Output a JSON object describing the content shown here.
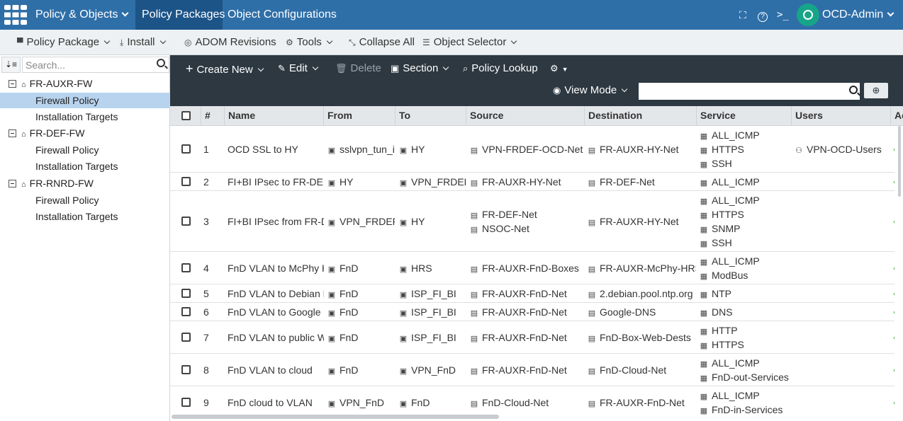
{
  "topbar": {
    "menu_label": "Policy & Objects",
    "tab_packages": "Policy Packages",
    "tab_objects": "Object Configurations",
    "user": "OCD-Admin"
  },
  "toolbar": {
    "policy_package": "Policy Package",
    "install": "Install",
    "adom_revisions": "ADOM Revisions",
    "tools": "Tools",
    "collapse_all": "Collapse All",
    "object_selector": "Object Selector"
  },
  "sidebar": {
    "search_placeholder": "Search...",
    "devices": [
      {
        "name": "FR-AUXR-FW",
        "policy": "Firewall Policy",
        "targets": "Installation Targets"
      },
      {
        "name": "FR-DEF-FW",
        "policy": "Firewall Policy",
        "targets": "Installation Targets"
      },
      {
        "name": "FR-RNRD-FW",
        "policy": "Firewall Policy",
        "targets": "Installation Targets"
      }
    ]
  },
  "actions": {
    "create_new": "Create New",
    "edit": "Edit",
    "delete": "Delete",
    "section": "Section",
    "policy_lookup": "Policy Lookup",
    "view_mode": "View Mode"
  },
  "table": {
    "headers": {
      "num": "#",
      "name": "Name",
      "from": "From",
      "to": "To",
      "source": "Source",
      "destination": "Destination",
      "service": "Service",
      "users": "Users",
      "action": "Ac"
    },
    "rows": [
      {
        "num": "1",
        "name": "OCD SSL to HY",
        "from": "sslvpn_tun_ir",
        "to": "HY",
        "source": [
          "VPN-FRDEF-OCD-Net"
        ],
        "destination": [
          "FR-AUXR-HY-Net"
        ],
        "service": [
          "ALL_ICMP",
          "HTTPS",
          "SSH"
        ],
        "users": "VPN-OCD-Users"
      },
      {
        "num": "2",
        "name": "FI+BI IPsec to FR-DEF",
        "from": "HY",
        "to": "VPN_FRDEF",
        "source": [
          "FR-AUXR-HY-Net"
        ],
        "destination": [
          "FR-DEF-Net"
        ],
        "service": [
          "ALL_ICMP"
        ],
        "users": ""
      },
      {
        "num": "3",
        "name": "FI+BI IPsec from FR-D",
        "from": "VPN_FRDEF",
        "to": "HY",
        "source": [
          "FR-DEF-Net",
          "NSOC-Net"
        ],
        "destination": [
          "FR-AUXR-HY-Net"
        ],
        "service": [
          "ALL_ICMP",
          "HTTPS",
          "SNMP",
          "SSH"
        ],
        "users": ""
      },
      {
        "num": "4",
        "name": "FnD VLAN to McPhy H",
        "from": "FnD",
        "to": "HRS",
        "source": [
          "FR-AUXR-FnD-Boxes"
        ],
        "destination": [
          "FR-AUXR-McPhy-HRS"
        ],
        "service": [
          "ALL_ICMP",
          "ModBus"
        ],
        "users": ""
      },
      {
        "num": "5",
        "name": "FnD VLAN to Debian N",
        "from": "FnD",
        "to": "ISP_FI_BI",
        "source": [
          "FR-AUXR-FnD-Net"
        ],
        "destination": [
          "2.debian.pool.ntp.org"
        ],
        "service": [
          "NTP"
        ],
        "users": ""
      },
      {
        "num": "6",
        "name": "FnD VLAN to Google D",
        "from": "FnD",
        "to": "ISP_FI_BI",
        "source": [
          "FR-AUXR-FnD-Net"
        ],
        "destination": [
          "Google-DNS"
        ],
        "service": [
          "DNS"
        ],
        "users": ""
      },
      {
        "num": "7",
        "name": "FnD VLAN to public W",
        "from": "FnD",
        "to": "ISP_FI_BI",
        "source": [
          "FR-AUXR-FnD-Net"
        ],
        "destination": [
          "FnD-Box-Web-Dests"
        ],
        "service": [
          "HTTP",
          "HTTPS"
        ],
        "users": ""
      },
      {
        "num": "8",
        "name": "FnD VLAN to cloud",
        "from": "FnD",
        "to": "VPN_FnD",
        "source": [
          "FR-AUXR-FnD-Net"
        ],
        "destination": [
          "FnD-Cloud-Net"
        ],
        "service": [
          "ALL_ICMP",
          "FnD-out-Services"
        ],
        "users": ""
      },
      {
        "num": "9",
        "name": "FnD cloud to VLAN",
        "from": "VPN_FnD",
        "to": "FnD",
        "source": [
          "FnD-Cloud-Net"
        ],
        "destination": [
          "FR-AUXR-FnD-Net"
        ],
        "service": [
          "ALL_ICMP",
          "FnD-in-Services"
        ],
        "users": ""
      }
    ]
  }
}
